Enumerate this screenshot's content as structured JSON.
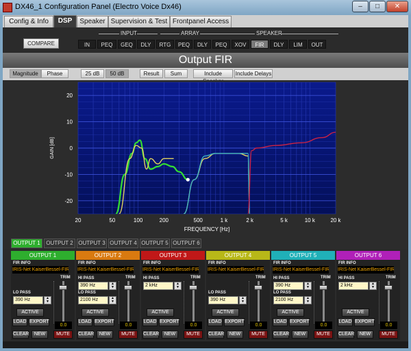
{
  "window": {
    "title": "DX46_1 Configuration Panel (Electro Voice Dx46)",
    "min": "–",
    "max": "□",
    "close": "✕"
  },
  "tabs": [
    "Config & Info",
    "DSP",
    "Speaker",
    "Supervision & Test",
    "Frontpanel Access"
  ],
  "groups": {
    "input": "INPUT",
    "array": "ARRAY",
    "speaker": "SPEAKER"
  },
  "compare": "COMPARE",
  "dsp_buttons": [
    "IN",
    "PEQ",
    "GEQ",
    "DLY",
    "RTG",
    "PEQ",
    "DLY",
    "PEQ",
    "XOV",
    "FIR",
    "DLY",
    "LIM",
    "OUT"
  ],
  "page_title": "Output FIR",
  "toolbar": [
    "Magnitude",
    "Phase",
    "25 dB",
    "50 dB",
    "Result",
    "Sum",
    "Include Speaker",
    "Include Delays"
  ],
  "output_tabs": [
    "OUTPUT 1",
    "OUTPUT 2",
    "OUTPUT 3",
    "OUTPUT 4",
    "OUTPUT 5",
    "OUTPUT 6"
  ],
  "chart_data": {
    "type": "line",
    "xlabel": "FREQUENCY [Hz]",
    "ylabel": "GAIN [dB]",
    "xscale": "log",
    "xlim": [
      20,
      20000
    ],
    "ylim": [
      -25,
      25
    ],
    "xticks": [
      "20",
      "50",
      "100",
      "200",
      "500",
      "1 k",
      "2 k",
      "5 k",
      "10 k",
      "20 k"
    ],
    "yticks": [
      "20",
      "10",
      "0",
      "-10",
      "-20"
    ],
    "grid": true,
    "series": [
      {
        "color": "#33dd33",
        "x": [
          55,
          70,
          85,
          95,
          105,
          120,
          140,
          170,
          200,
          250,
          300,
          380
        ],
        "y": [
          -25,
          -10,
          -2,
          2,
          3,
          -4,
          -8,
          -7,
          -6,
          -7,
          -9,
          -12
        ]
      },
      {
        "color": "#e0d060",
        "x": [
          60,
          80,
          95,
          110,
          125,
          140,
          170,
          200,
          260
        ],
        "y": [
          -25,
          -4,
          1,
          0,
          -8,
          -4,
          -6,
          -4,
          -4
        ]
      },
      {
        "color": "#e0d060",
        "x": [
          340,
          450,
          600,
          800,
          1000,
          1500,
          1900,
          2000
        ],
        "y": [
          -25,
          -12,
          -4,
          -2,
          -2,
          -2,
          -3,
          -25
        ]
      },
      {
        "color": "#40b0c0",
        "x": [
          340,
          450,
          600,
          800,
          1000,
          1500,
          1900,
          2000
        ],
        "y": [
          -25,
          -12,
          -3,
          -2,
          -2,
          -2,
          -2,
          -25
        ]
      },
      {
        "color": "#cc2244",
        "x": [
          1900,
          2100,
          2400,
          4000,
          8000,
          14000,
          20000
        ],
        "y": [
          -25,
          -1,
          0,
          1,
          2,
          4,
          6
        ]
      }
    ]
  },
  "marker": "●",
  "labels": {
    "fir_info": "FIR INFO",
    "lo_pass": "LO PASS",
    "hi_pass": "HI PASS",
    "trim": "TRIM",
    "active": "ACTIVE",
    "load": "LOAD",
    "export": "EXPORT",
    "clear": "CLEAR",
    "new": "NEW",
    "mute": "MUTE"
  },
  "outputs": [
    {
      "name": "OUTPUT 1",
      "color": "#2eae2e",
      "fir": "IRIS-Net KaiserBessel-FIR LP",
      "hi": null,
      "lo": "390 Hz",
      "trim": "0.0"
    },
    {
      "name": "OUTPUT 2",
      "color": "#d97a10",
      "fir": "IRIS-Net KaiserBessel-FIR BP",
      "hi": "390 Hz",
      "lo": "2100 Hz",
      "trim": "0.0"
    },
    {
      "name": "OUTPUT 3",
      "color": "#c01818",
      "fir": "IRIS-Net KaiserBessel-FIR HP",
      "hi": "2 kHz",
      "lo": null,
      "trim": "0.0"
    },
    {
      "name": "OUTPUT 4",
      "color": "#b8b818",
      "fir": "IRIS-Net KaiserBessel-FIR LP",
      "hi": null,
      "lo": "390 Hz",
      "trim": "0.0"
    },
    {
      "name": "OUTPUT 5",
      "color": "#20b0b8",
      "fir": "IRIS-Net KaiserBessel-FIR BP",
      "hi": "390 Hz",
      "lo": "2100 Hz",
      "trim": "0.0"
    },
    {
      "name": "OUTPUT 6",
      "color": "#b020b8",
      "fir": "IRIS-Net KaiserBessel-FIR HP",
      "hi": "2 kHz",
      "lo": null,
      "trim": "0.0"
    }
  ]
}
